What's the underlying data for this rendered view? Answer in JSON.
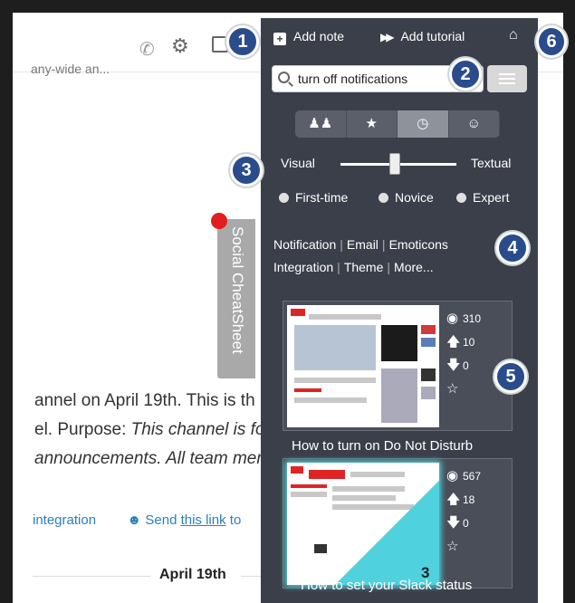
{
  "background_app": {
    "topic_snippet": "any-wide an...",
    "message_line1": "annel on April 19th. This is th",
    "message_line2_prefix": "el. Purpose: ",
    "message_line2_italic": "This channel is for t",
    "message_line3": "announcements. All team mem",
    "link_integration": "integration",
    "link_send_prefix": "Send ",
    "link_send_underlined": "this link",
    "link_send_suffix": " to",
    "date_divider": "April 19th",
    "icons": [
      "phone-icon",
      "gear-icon",
      "panel-icon",
      "search-icon"
    ]
  },
  "cheatsheet_tab": {
    "label": "Social CheatSheet"
  },
  "panel": {
    "top_actions": {
      "add_note": "Add note",
      "add_tutorial": "Add tutorial"
    },
    "search": {
      "value": "turn off notifications",
      "placeholder": "Search"
    },
    "mode_tabs": [
      "people-icon",
      "star-icon",
      "clock-icon",
      "user-icon"
    ],
    "active_mode_index": 2,
    "slider": {
      "left_label": "Visual",
      "right_label": "Textual",
      "level": 0.5
    },
    "expertise": [
      "First-time",
      "Novice",
      "Expert"
    ],
    "categories_line1": [
      "Notification",
      "Email",
      "Emoticons"
    ],
    "categories_line2": [
      "Integration",
      "Theme",
      "More..."
    ],
    "cards": [
      {
        "title": "How to turn on Do Not Disturb",
        "views": "310",
        "upvotes": "10",
        "downvotes": "0"
      },
      {
        "title": "How to set your Slack status",
        "views": "567",
        "upvotes": "18",
        "downvotes": "0",
        "corner_number": "3"
      }
    ]
  },
  "callouts": [
    "1",
    "2",
    "3",
    "4",
    "5",
    "6"
  ],
  "colors": {
    "panel_bg": "#3b3f49",
    "badge_bg": "#2a4c8c",
    "notif_dot": "#e31e1e",
    "highlight_teal": "#4fd2de"
  }
}
